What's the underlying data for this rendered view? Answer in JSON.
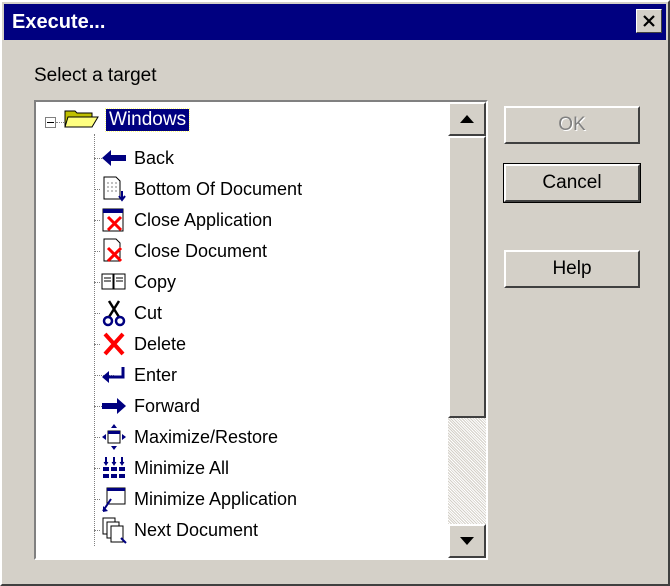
{
  "dialog": {
    "title": "Execute..."
  },
  "target_label": "Select a target",
  "tree": {
    "root": {
      "label": "Windows",
      "icon": "folder-open-icon",
      "expanded": true,
      "selected": true
    },
    "items": [
      {
        "label": "Back",
        "icon": "arrow-left-icon"
      },
      {
        "label": "Bottom Of Document",
        "icon": "document-bottom-icon"
      },
      {
        "label": "Close Application",
        "icon": "close-application-icon"
      },
      {
        "label": "Close Document",
        "icon": "close-document-icon"
      },
      {
        "label": "Copy",
        "icon": "copy-icon"
      },
      {
        "label": "Cut",
        "icon": "scissors-icon"
      },
      {
        "label": "Delete",
        "icon": "delete-x-icon"
      },
      {
        "label": "Enter",
        "icon": "enter-arrow-icon"
      },
      {
        "label": "Forward",
        "icon": "arrow-right-icon"
      },
      {
        "label": "Maximize/Restore",
        "icon": "maximize-restore-icon"
      },
      {
        "label": "Minimize All",
        "icon": "minimize-all-icon"
      },
      {
        "label": "Minimize Application",
        "icon": "minimize-application-icon"
      },
      {
        "label": "Next Document",
        "icon": "next-document-icon"
      }
    ]
  },
  "buttons": {
    "ok": {
      "label": "OK",
      "enabled": false
    },
    "cancel": {
      "label": "Cancel"
    },
    "help": {
      "label": "Help"
    }
  },
  "colors": {
    "title_bar": "#000080",
    "face": "#d4d0c8",
    "selection": "#000080",
    "delete_red": "#ff0000"
  }
}
